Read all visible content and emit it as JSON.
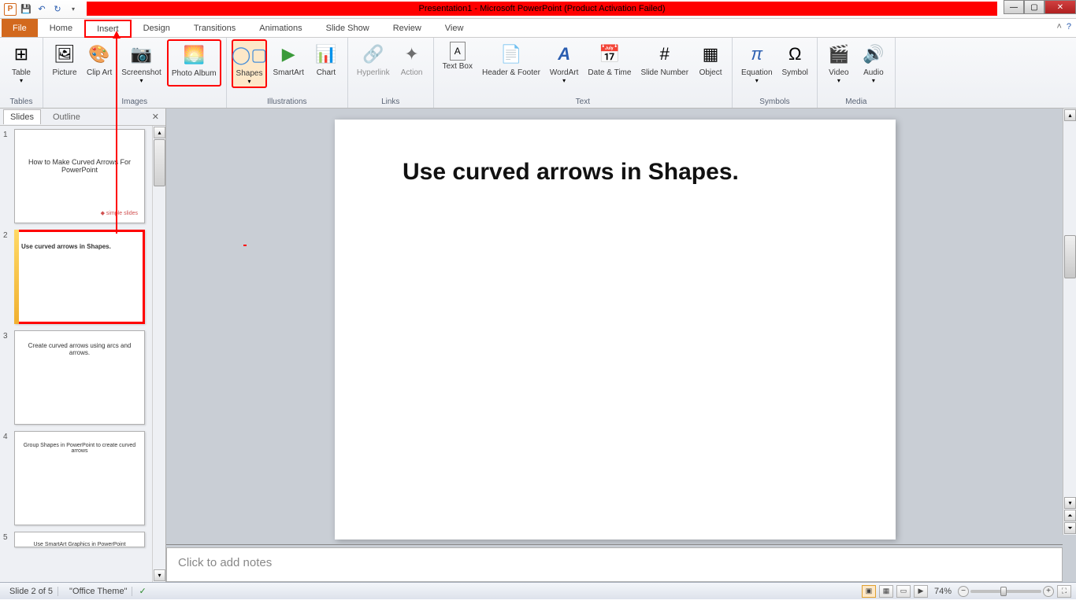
{
  "title": "Presentation1 - Microsoft PowerPoint (Product Activation Failed)",
  "qat": {
    "app_letter": "P"
  },
  "tabs": {
    "file": "File",
    "home": "Home",
    "insert": "Insert",
    "design": "Design",
    "transitions": "Transitions",
    "animations": "Animations",
    "slideshow": "Slide Show",
    "review": "Review",
    "view": "View"
  },
  "ribbon": {
    "tables_group": "Tables",
    "table": "Table",
    "images_group": "Images",
    "picture": "Picture",
    "clipart": "Clip\nArt",
    "screenshot": "Screenshot",
    "photoalbum": "Photo\nAlbum",
    "illustrations_group": "Illustrations",
    "shapes": "Shapes",
    "smartart": "SmartArt",
    "chart": "Chart",
    "links_group": "Links",
    "hyperlink": "Hyperlink",
    "action": "Action",
    "text_group": "Text",
    "textbox": "Text\nBox",
    "headerfooter": "Header\n& Footer",
    "wordart": "WordArt",
    "datetime": "Date\n& Time",
    "slidenumber": "Slide\nNumber",
    "object": "Object",
    "symbols_group": "Symbols",
    "equation": "Equation",
    "symbol": "Symbol",
    "media_group": "Media",
    "video": "Video",
    "audio": "Audio"
  },
  "panel": {
    "slides_tab": "Slides",
    "outline_tab": "Outline"
  },
  "slides": [
    {
      "num": "1",
      "text": "How to Make Curved Arrows For PowerPoint",
      "brand": "simple slides"
    },
    {
      "num": "2",
      "text": "Use curved arrows in Shapes."
    },
    {
      "num": "3",
      "text": "Create curved arrows using arcs and arrows."
    },
    {
      "num": "4",
      "text": "Group Shapes in PowerPoint to create curved arrows"
    },
    {
      "num": "5",
      "text": "Use SmartArt Graphics in PowerPoint"
    }
  ],
  "current_slide_title": "Use curved arrows in Shapes.",
  "notes_placeholder": "Click to add notes",
  "status": {
    "slide_info": "Slide 2 of 5",
    "theme": "\"Office Theme\"",
    "zoom": "74%"
  }
}
